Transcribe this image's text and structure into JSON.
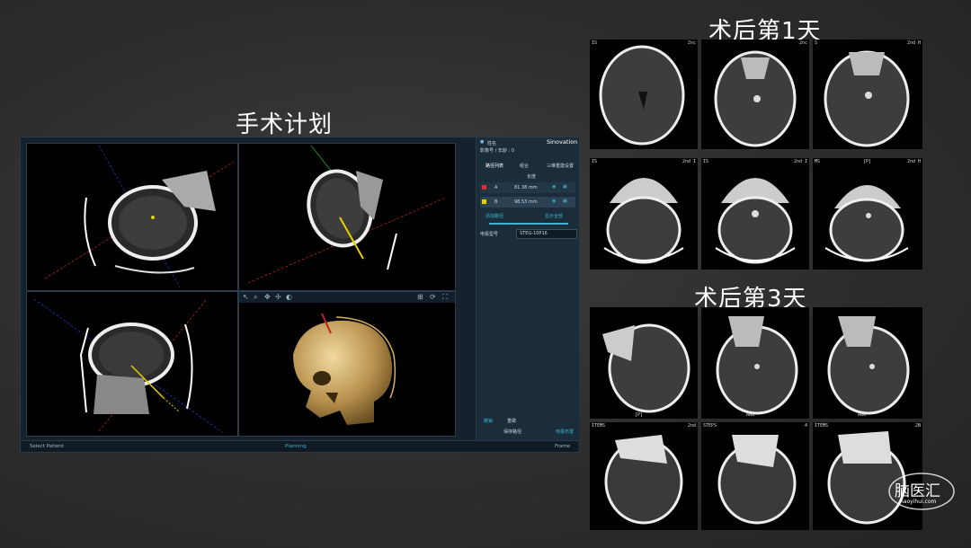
{
  "headings": {
    "plan": "手术计划",
    "day1": "术后第1天",
    "day3": "术后第3天"
  },
  "software": {
    "brand": "Sinovation",
    "patient_line": "姓名",
    "study_line": "影像号 / 年龄 : 0",
    "tabs": [
      "路径列表",
      "组合",
      "三维重建设置"
    ],
    "list_header": "长度",
    "paths": [
      {
        "name": "A",
        "length": "81.38 mm",
        "color": "#e03030"
      },
      {
        "name": "B",
        "length": "98.53 mm",
        "color": "#e8d000"
      }
    ],
    "action_left": "添加路径",
    "action_right": "显示全部",
    "device_label": "电极型号",
    "device_value": "STEG-10P16",
    "undo": "撤销",
    "redo": "重做",
    "save": "保存路径",
    "confirm": "电极布置",
    "bottom_left": "Select Patient",
    "bottom_center": "Planning",
    "bottom_right": "Frame"
  },
  "day1_scans": [
    {
      "tl": "IS",
      "tr": "2nc"
    },
    {
      "tl": "",
      "tr": "2nc"
    },
    {
      "tl": "S",
      "tr": "2nd H"
    },
    {
      "tl": "IS",
      "tr": "2nd I"
    },
    {
      "tl": "IS",
      "tr": "2nd I"
    },
    {
      "tl": "MS",
      "tr": "2nd H",
      "tc": "[P]"
    }
  ],
  "day3_scans": [
    {
      "tl": "",
      "tr": "",
      "bl": "[P]"
    },
    {
      "tl": "",
      "tr": "",
      "bl": "ANN"
    },
    {
      "tl": "",
      "tr": "",
      "bl": "ANN"
    },
    {
      "tl": "ITEMS",
      "tr": "2nd"
    },
    {
      "tl": "STEPS",
      "tr": "4"
    },
    {
      "tl": "ITEMS",
      "tr": "2N"
    }
  ],
  "watermark": {
    "text": "脑医汇",
    "sub": "naoyihui.com"
  }
}
